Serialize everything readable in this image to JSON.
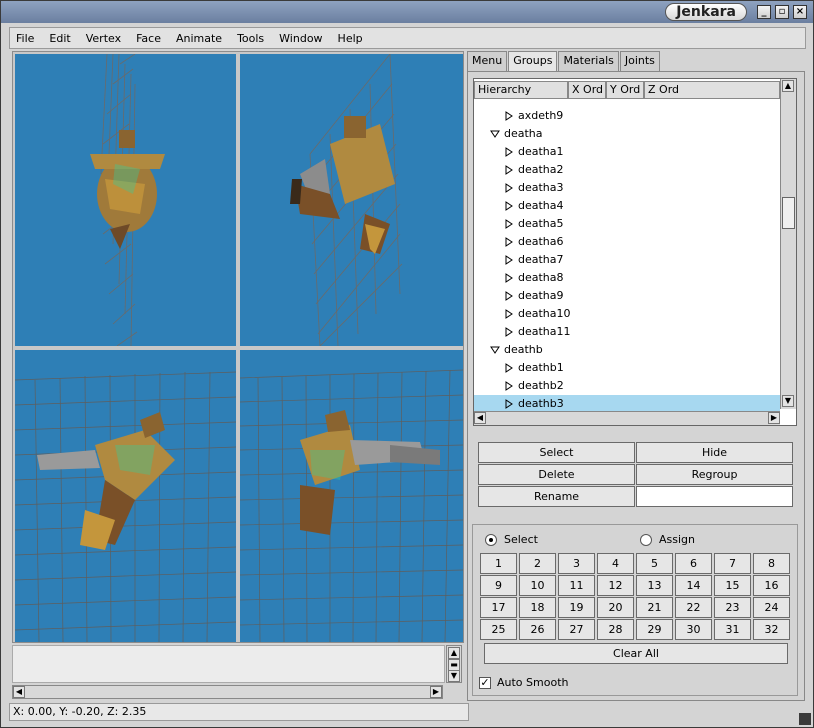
{
  "window": {
    "title": "Jenkara",
    "buttons": [
      "_",
      "▫",
      "×"
    ]
  },
  "menu": [
    "File",
    "Edit",
    "Vertex",
    "Face",
    "Animate",
    "Tools",
    "Window",
    "Help"
  ],
  "tabs": [
    {
      "label": "Menu",
      "active": false
    },
    {
      "label": "Groups",
      "active": true
    },
    {
      "label": "Materials",
      "active": false
    },
    {
      "label": "Joints",
      "active": false
    }
  ],
  "tree": {
    "columns": [
      "Hierarchy",
      "X Ord",
      "Y Ord",
      "Z Ord"
    ],
    "rows": [
      {
        "label": "axdeth9",
        "level": 1,
        "expanded": false,
        "selected": false
      },
      {
        "label": "deatha",
        "level": 0,
        "expanded": true,
        "selected": false
      },
      {
        "label": "deatha1",
        "level": 1,
        "expanded": false,
        "selected": false
      },
      {
        "label": "deatha2",
        "level": 1,
        "expanded": false,
        "selected": false
      },
      {
        "label": "deatha3",
        "level": 1,
        "expanded": false,
        "selected": false
      },
      {
        "label": "deatha4",
        "level": 1,
        "expanded": false,
        "selected": false
      },
      {
        "label": "deatha5",
        "level": 1,
        "expanded": false,
        "selected": false
      },
      {
        "label": "deatha6",
        "level": 1,
        "expanded": false,
        "selected": false
      },
      {
        "label": "deatha7",
        "level": 1,
        "expanded": false,
        "selected": false
      },
      {
        "label": "deatha8",
        "level": 1,
        "expanded": false,
        "selected": false
      },
      {
        "label": "deatha9",
        "level": 1,
        "expanded": false,
        "selected": false
      },
      {
        "label": "deatha10",
        "level": 1,
        "expanded": false,
        "selected": false
      },
      {
        "label": "deatha11",
        "level": 1,
        "expanded": false,
        "selected": false
      },
      {
        "label": "deathb",
        "level": 0,
        "expanded": true,
        "selected": false
      },
      {
        "label": "deathb1",
        "level": 1,
        "expanded": false,
        "selected": false
      },
      {
        "label": "deathb2",
        "level": 1,
        "expanded": false,
        "selected": false
      },
      {
        "label": "deathb3",
        "level": 1,
        "expanded": false,
        "selected": true
      }
    ]
  },
  "group_buttons": {
    "select": "Select",
    "hide": "Hide",
    "delete": "Delete",
    "regroup": "Regroup",
    "rename": "Rename",
    "rename_value": ""
  },
  "bone_select": {
    "select_label": "Select",
    "assign_label": "Assign",
    "mode": "Select",
    "numbers": [
      "1",
      "2",
      "3",
      "4",
      "5",
      "6",
      "7",
      "8",
      "9",
      "10",
      "11",
      "12",
      "13",
      "14",
      "15",
      "16",
      "17",
      "18",
      "19",
      "20",
      "21",
      "22",
      "23",
      "24",
      "25",
      "26",
      "27",
      "28",
      "29",
      "30",
      "31",
      "32"
    ],
    "clear_all": "Clear All",
    "auto_smooth_label": "Auto Smooth",
    "auto_smooth_checked": true
  },
  "status": "X: 0.00, Y: -0.20, Z: 2.35",
  "colors": {
    "viewport_bg": "#2e7fb6",
    "selection": "#a7d8f0",
    "titlebar": "#7a8eae"
  }
}
